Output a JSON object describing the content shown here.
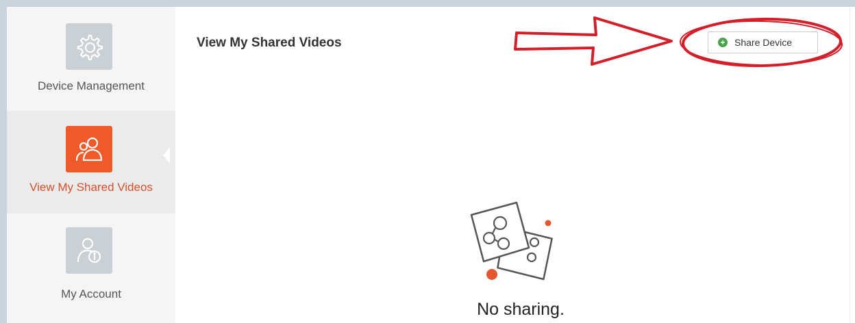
{
  "sidebar": {
    "items": [
      {
        "label": "Device Management",
        "icon": "gear-icon",
        "active": false
      },
      {
        "label": "View My Shared Videos",
        "icon": "users-icon",
        "active": true
      },
      {
        "label": "My Account",
        "icon": "account-info-icon",
        "active": false
      }
    ]
  },
  "main": {
    "title": "View My Shared Videos",
    "share_button_label": "Share Device",
    "empty_text": "No sharing."
  },
  "colors": {
    "accent": "#ef5a2a",
    "inactive_icon_bg": "#c9d0d6",
    "annotation": "#d21f2a",
    "add_icon": "#4aa34a"
  }
}
